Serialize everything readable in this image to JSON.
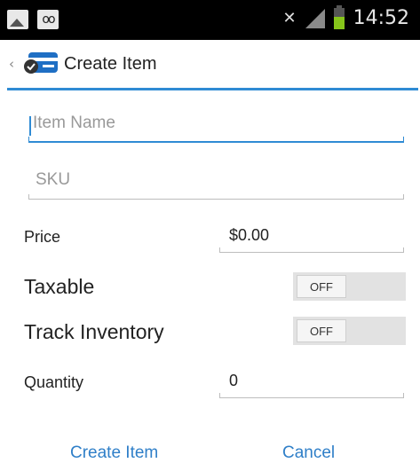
{
  "status_bar": {
    "time": "14:52",
    "icons": [
      "image-notification-icon",
      "voicemail-icon",
      "mute-icon",
      "signal-icon",
      "battery-icon"
    ],
    "battery_color": "#86c51a"
  },
  "action_bar": {
    "back_glyph": "‹",
    "title": "Create Item",
    "accent_color": "#2f8bd4"
  },
  "form": {
    "item_name": {
      "value": "",
      "placeholder": "Item Name"
    },
    "sku": {
      "value": "",
      "placeholder": "SKU"
    },
    "price": {
      "label": "Price",
      "value": "$0.00"
    },
    "taxable": {
      "label": "Taxable",
      "state": "OFF"
    },
    "track_inventory": {
      "label": "Track Inventory",
      "state": "OFF"
    },
    "quantity": {
      "label": "Quantity",
      "value": "0"
    }
  },
  "buttons": {
    "create": "Create Item",
    "cancel": "Cancel"
  }
}
